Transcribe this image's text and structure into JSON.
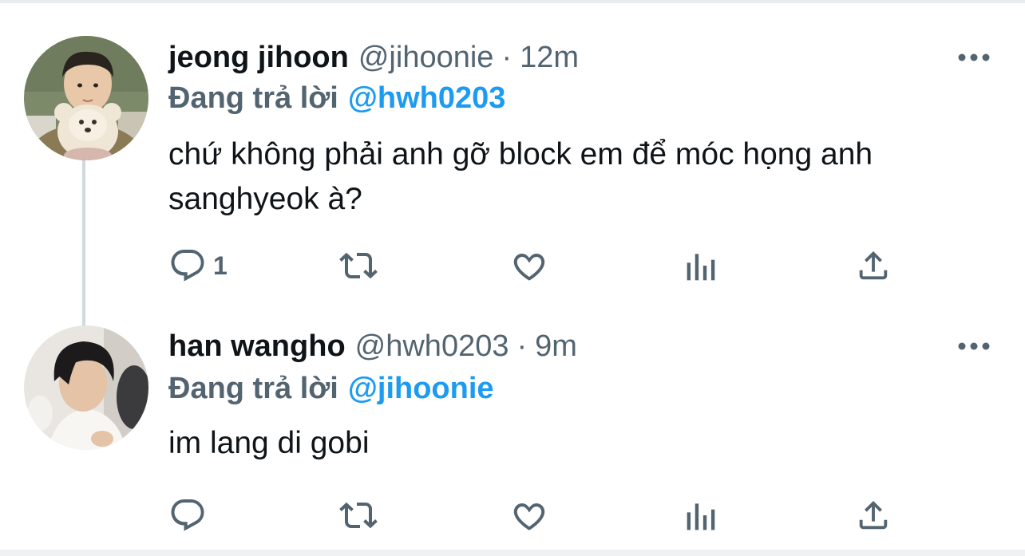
{
  "theme": {
    "text_color": "#0f1419",
    "muted_color": "#536471",
    "accent_color": "#1d9bf0",
    "thread_line_color": "#cfd9de"
  },
  "tweets": [
    {
      "display_name": "jeong jihoon",
      "handle": "@jihoonie",
      "separator": "·",
      "time": "12m",
      "reply_prefix": "Đang trả lời",
      "reply_to": "@hwh0203",
      "text": "chứ không phải anh gỡ block em để móc họng anh sanghyeok à?",
      "reply_count": "1",
      "avatar_icon": "avatar-child-with-teddy-bear"
    },
    {
      "display_name": "han wangho",
      "handle": "@hwh0203",
      "separator": "·",
      "time": "9m",
      "reply_prefix": "Đang trả lời",
      "reply_to": "@jihoonie",
      "text": "im lang di gobi",
      "reply_count": "",
      "avatar_icon": "avatar-person-portrait"
    }
  ],
  "actions": {
    "reply_icon": "comment-icon",
    "retweet_icon": "retweet-icon",
    "like_icon": "heart-icon",
    "analytics_icon": "analytics-icon",
    "share_icon": "share-icon",
    "more_icon": "more-horizontal-icon"
  }
}
